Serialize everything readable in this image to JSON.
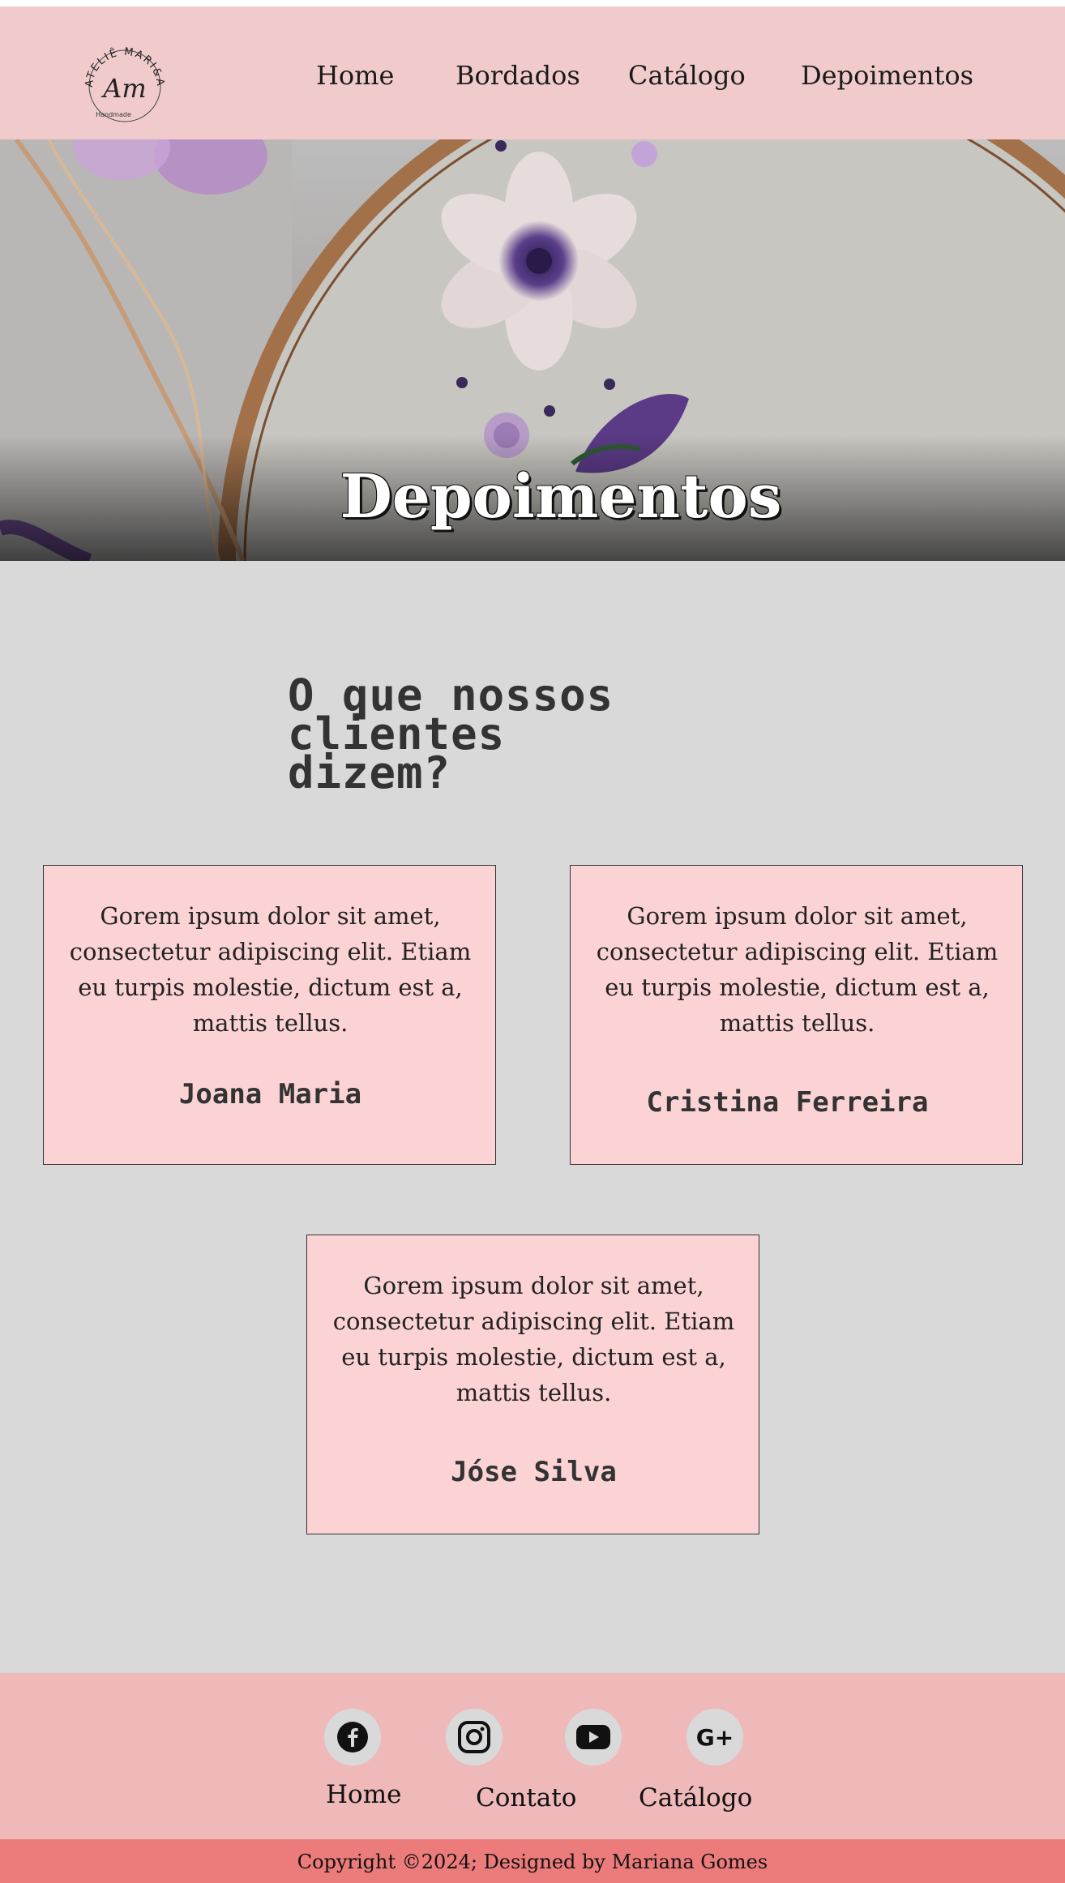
{
  "header": {
    "logo": {
      "brand_line": "ATELIÊ MARI&ART",
      "monogram": "Am",
      "tagline": "Handmade"
    },
    "nav": [
      {
        "label": "Home"
      },
      {
        "label": "Bordados"
      },
      {
        "label": "Catálogo"
      },
      {
        "label": "Depoimentos"
      }
    ]
  },
  "hero": {
    "title": "Depoimentos"
  },
  "testimonials": {
    "heading_line1": "O que nossos clientes",
    "heading_line2": "dizem?",
    "cards": [
      {
        "text": "Gorem ipsum dolor sit amet, consectetur adipiscing elit. Etiam eu turpis molestie, dictum est a, mattis tellus.",
        "name": "Joana Maria"
      },
      {
        "text": "Gorem ipsum dolor sit amet, consectetur adipiscing elit. Etiam eu turpis molestie, dictum est a, mattis tellus.",
        "name": "Cristina Ferreira"
      },
      {
        "text": "Gorem ipsum dolor sit amet, consectetur adipiscing elit. Etiam eu turpis molestie, dictum est a, mattis tellus.",
        "name": "Jóse Silva"
      }
    ]
  },
  "footer": {
    "social": [
      {
        "icon": "facebook-icon"
      },
      {
        "icon": "instagram-icon"
      },
      {
        "icon": "youtube-icon"
      },
      {
        "icon": "google-plus-icon",
        "glyph": "G+"
      }
    ],
    "links": [
      {
        "label": "Home"
      },
      {
        "label": "Contato"
      },
      {
        "label": "Catálogo"
      }
    ],
    "copyright": "Copyright ©2024; Designed by Mariana Gomes"
  },
  "colors": {
    "header_bg": "#f1cbcb",
    "main_bg": "#d9d9d9",
    "card_bg": "#fcd3d4",
    "footer_bg": "#efb9b9",
    "copyright_bg": "#ec7b7b",
    "heading_text": "#333333"
  }
}
